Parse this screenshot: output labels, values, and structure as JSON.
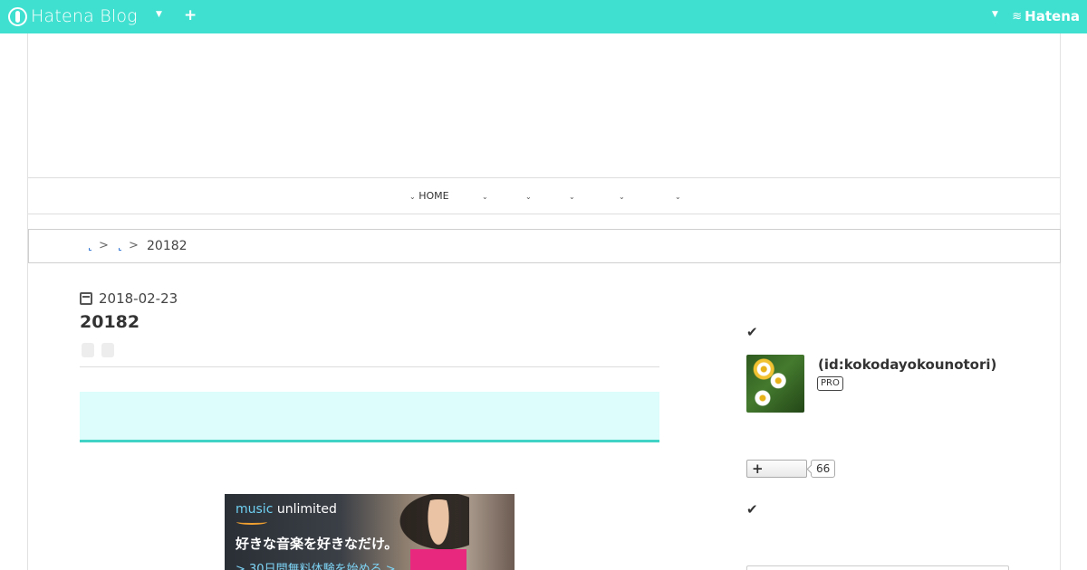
{
  "topbar": {
    "logo_text": "Hatena Blog",
    "brand": "Hatena",
    "icons": {
      "logo": "hatena-blog-logo-icon",
      "caret": "caret-down-icon",
      "add": "plus-icon",
      "brand": "hatena-wifi-icon"
    },
    "color": "#40e0d0"
  },
  "globalnav": {
    "items": [
      {
        "label": "HOME"
      },
      {
        "label": ""
      },
      {
        "label": ""
      },
      {
        "label": ""
      },
      {
        "label": ""
      },
      {
        "label": ""
      }
    ]
  },
  "breadcrumb": {
    "separator": ">",
    "current": "20182"
  },
  "article": {
    "date": "2018-02-23",
    "title": "20182"
  },
  "ad": {
    "brand_music": "music",
    "brand_rest": "unlimited",
    "headline": "好きな音楽を好きなだけ。",
    "cta": "> 30日間無料体験を始める >"
  },
  "sidebar": {
    "profile_check": "✔",
    "user_id": "(id:kokodayokounotori)",
    "pro_badge": "PRO",
    "follow_icon": "plus-icon",
    "follower_count": "66",
    "search_check": "✔",
    "search_value": ""
  }
}
